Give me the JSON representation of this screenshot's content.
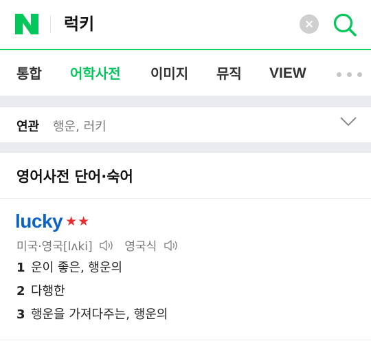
{
  "header": {
    "logo_letter": "N",
    "query": "럭키"
  },
  "tabs": [
    {
      "label": "통합"
    },
    {
      "label": "어학사전"
    },
    {
      "label": "이미지"
    },
    {
      "label": "뮤직"
    },
    {
      "label": "VIEW"
    }
  ],
  "related": {
    "label": "연관",
    "terms": "행운, 러키"
  },
  "dictionary": {
    "section_title": "영어사전 단어·숙어",
    "word": "lucky",
    "stars": "★★",
    "pron_us_uk": "미국·영국[lʌki]",
    "pron_uk": "영국식",
    "meanings": [
      {
        "num": "1",
        "text": "운이 좋은, 행운의"
      },
      {
        "num": "2",
        "text": "다행한"
      },
      {
        "num": "3",
        "text": "행운을 가져다주는, 행운의"
      }
    ]
  },
  "colors": {
    "naver_green": "#03c75a",
    "word_blue": "#0c63c7",
    "star_red": "#e52e2e"
  }
}
